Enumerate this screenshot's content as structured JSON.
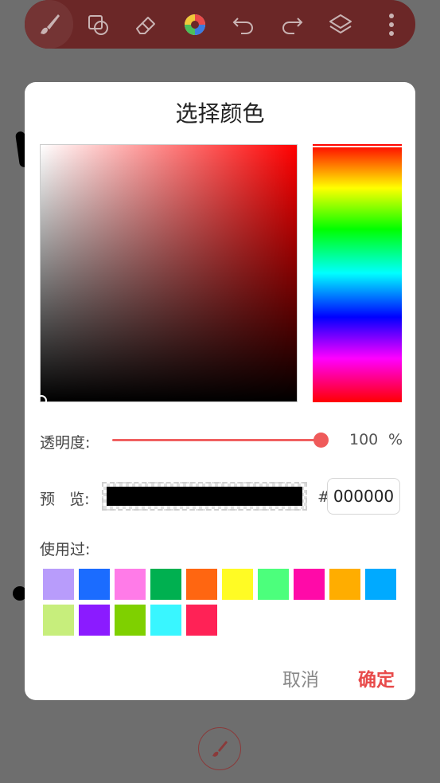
{
  "toolbar": {
    "items": [
      {
        "name": "brush-tool",
        "icon": "brush-icon"
      },
      {
        "name": "shape-tool",
        "icon": "shapes-icon"
      },
      {
        "name": "eraser-tool",
        "icon": "eraser-icon"
      },
      {
        "name": "color-tool",
        "icon": "color-wheel-icon"
      },
      {
        "name": "undo",
        "icon": "undo-icon"
      },
      {
        "name": "redo",
        "icon": "redo-icon"
      },
      {
        "name": "layers",
        "icon": "layers-icon"
      },
      {
        "name": "more",
        "icon": "more-vertical-icon"
      }
    ],
    "active_index": 0,
    "background": "#6b2727"
  },
  "dialog": {
    "title": "选择颜色",
    "picker": {
      "hue_color": "#ff0000",
      "selected_color": "#000000"
    },
    "alpha": {
      "label": "透明度:",
      "value": "100",
      "unit": "%",
      "fraction": 1.0
    },
    "preview": {
      "label": "预   览:",
      "hash": "#",
      "hex_value": "000000"
    },
    "recent": {
      "label": "使用过:",
      "colors": [
        "#b89cfb",
        "#1b6cff",
        "#ff7be8",
        "#00b050",
        "#ff6611",
        "#fffb24",
        "#4cff7c",
        "#ff0aa8",
        "#ffad00",
        "#00aaff",
        "#c7ee7c",
        "#8b1bff",
        "#7fd000",
        "#39f6ff",
        "#ff2256"
      ]
    },
    "cancel_label": "取消",
    "confirm_label": "确定"
  },
  "colors": {
    "accent": "#e84b4b",
    "dim_overlay": "#6e6e6e"
  }
}
